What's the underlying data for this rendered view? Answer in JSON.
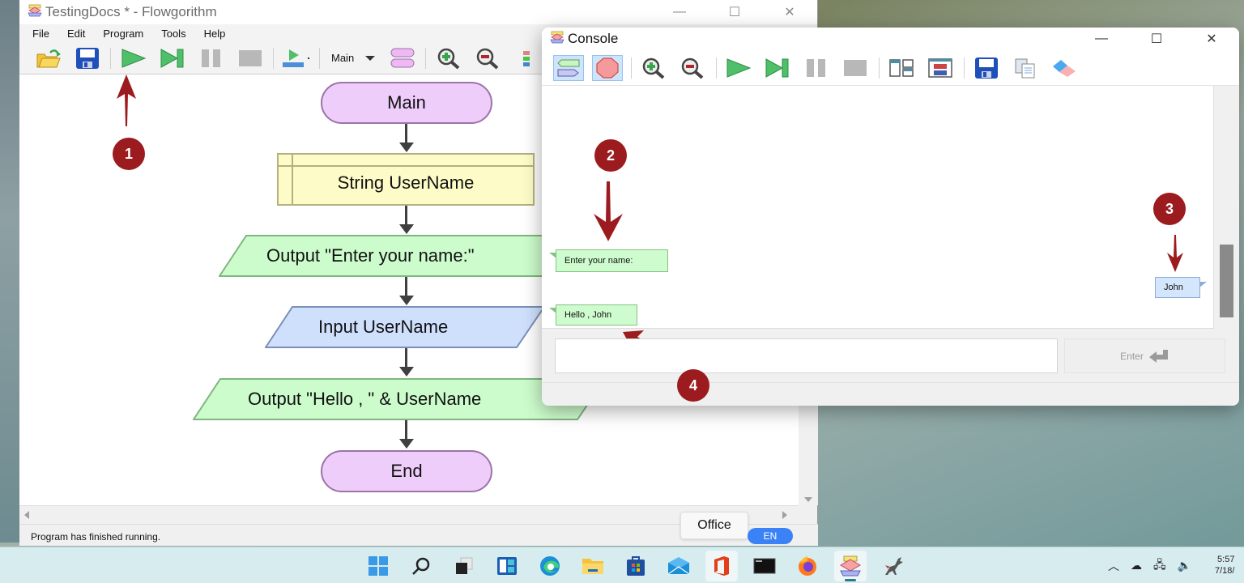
{
  "main_window": {
    "title": "TestingDocs * - Flowgorithm",
    "controls": {
      "minimize": "—",
      "maximize": "☐",
      "close": "✕"
    },
    "menu": [
      "File",
      "Edit",
      "Program",
      "Tools",
      "Help"
    ],
    "toolbar": {
      "buttons": [
        "open-icon",
        "save-icon",
        "run-icon",
        "step-icon",
        "pause-icon",
        "stop-icon",
        "run-speed-icon"
      ],
      "function_select": "Main",
      "after": [
        "shapes-icon",
        "zoom-in-icon",
        "zoom-out-icon",
        "layout-icon"
      ]
    },
    "flowchart": {
      "start": "Main",
      "declare": "String UserName",
      "output1": "Output \"Enter your name:\"",
      "input": "Input UserName",
      "output2": "Output \"Hello , \" & UserName",
      "end": "End"
    },
    "status": "Program has finished running."
  },
  "console": {
    "title": "Console",
    "controls": {
      "minimize": "—",
      "maximize": "☐",
      "close": "✕"
    },
    "toolbar": [
      "chat-view-icon",
      "stop-sign-icon",
      "zoom-in-icon",
      "zoom-out-icon",
      "run-icon",
      "step-icon",
      "pause-icon",
      "stop-icon",
      "layout-side-icon",
      "layout-stack-icon",
      "save-icon",
      "copy-icon",
      "eraser-icon"
    ],
    "messages": [
      {
        "type": "output",
        "text": "Enter your name:"
      },
      {
        "type": "input",
        "text": "John"
      },
      {
        "type": "output",
        "text": "Hello , John"
      }
    ],
    "input_value": "",
    "enter_label": "Enter"
  },
  "annotations": [
    "1",
    "2",
    "3",
    "4"
  ],
  "tooltip": "Office",
  "language": "EN",
  "taskbar": {
    "apps": [
      "start",
      "search",
      "task-view",
      "widgets",
      "edge",
      "file-explorer",
      "store",
      "mail",
      "office",
      "terminal",
      "firefox",
      "flowgorithm",
      "dinosaur"
    ],
    "clock_time": "5:57",
    "clock_date": "7/18/"
  },
  "colors": {
    "terminal_fill": "#efcdfa",
    "declare_fill": "#fdfcc8",
    "output_fill": "#ccfccc",
    "input_fill": "#cfe0fc",
    "annotation": "#9c1b1e"
  }
}
